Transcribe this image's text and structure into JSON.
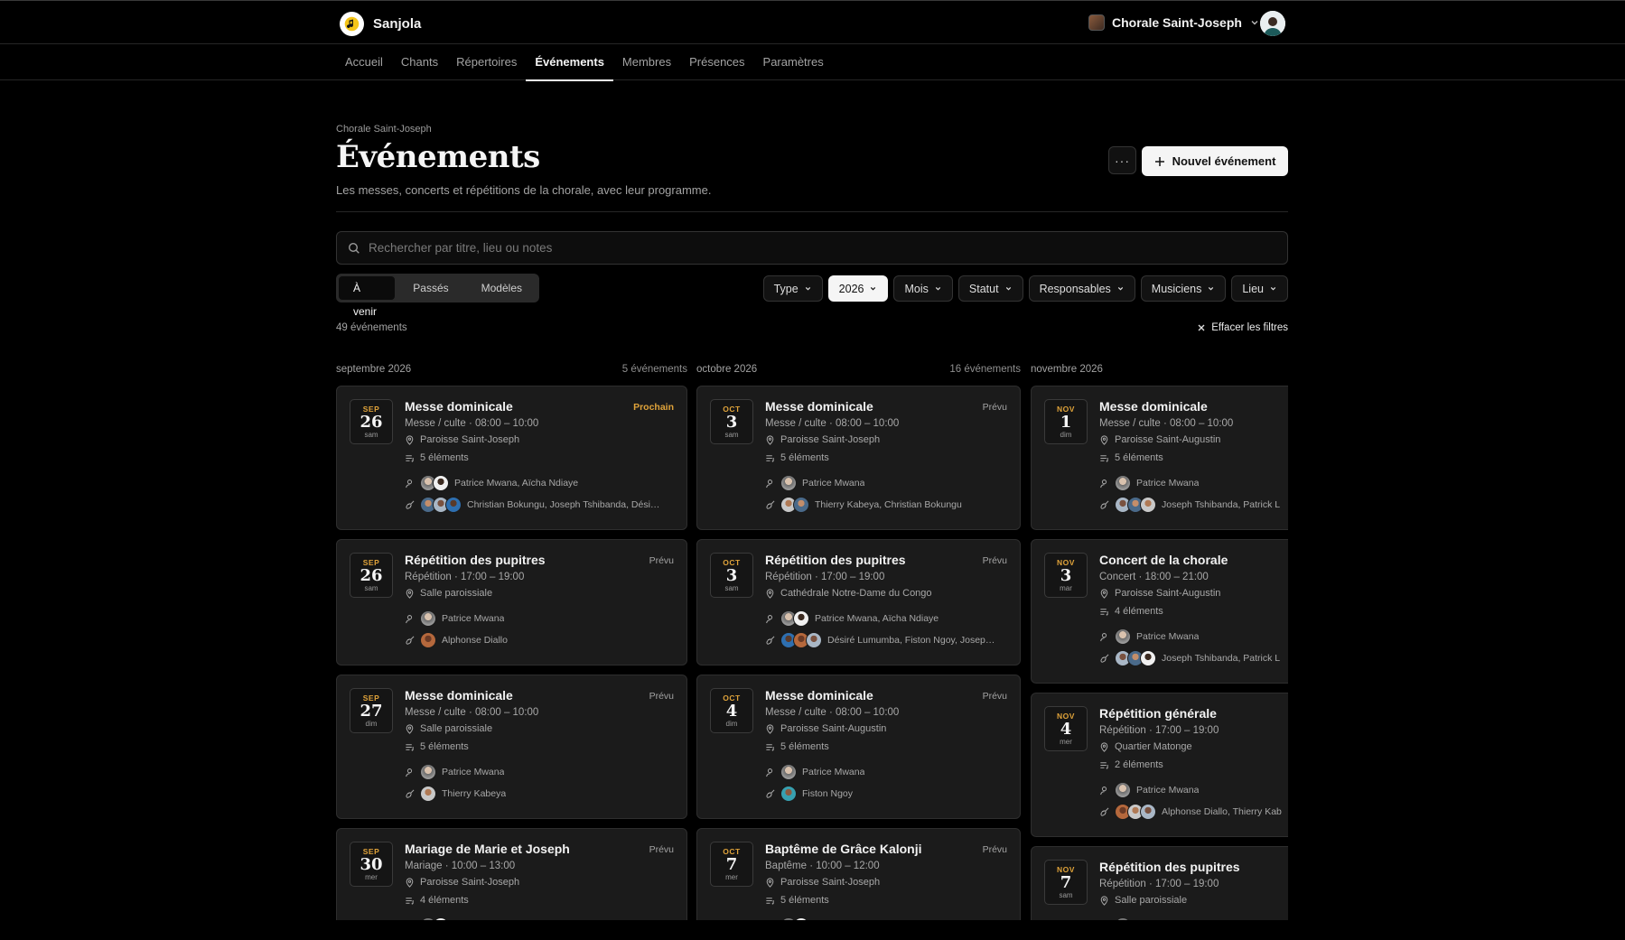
{
  "app": {
    "name": "Sanjola",
    "org": "Chorale Saint-Joseph"
  },
  "nav": {
    "tabs": [
      {
        "label": "Accueil"
      },
      {
        "label": "Chants"
      },
      {
        "label": "Répertoires"
      },
      {
        "label": "Événements",
        "active": true
      },
      {
        "label": "Membres"
      },
      {
        "label": "Présences"
      },
      {
        "label": "Paramètres"
      }
    ]
  },
  "header": {
    "breadcrumb": "Chorale Saint-Joseph",
    "title": "Événements",
    "subtitle": "Les messes, concerts et répétitions de la chorale, avec leur programme.",
    "more_label": "···",
    "new_button": "Nouvel événement"
  },
  "search": {
    "placeholder": "Rechercher par titre, lieu ou notes",
    "value": ""
  },
  "segments": [
    {
      "label": "À venir",
      "active": true
    },
    {
      "label": "Passés"
    },
    {
      "label": "Modèles"
    }
  ],
  "filters": [
    {
      "label": "Type"
    },
    {
      "label": "2026",
      "active": true
    },
    {
      "label": "Mois"
    },
    {
      "label": "Statut"
    },
    {
      "label": "Responsables"
    },
    {
      "label": "Musiciens"
    },
    {
      "label": "Lieu"
    }
  ],
  "summary": {
    "count": "49 événements",
    "clear": "Effacer les filtres"
  },
  "colors": {
    "accent": "#e0a33a",
    "background": "#000000",
    "card": "#1b1b1b"
  },
  "columns": [
    {
      "month": "septembre 2026",
      "count": "5 événements",
      "events": [
        {
          "mon": "SEP",
          "day": "26",
          "dow": "sam",
          "title": "Messe dominicale",
          "status": "Prochain",
          "next": true,
          "meta": "Messe / culte · 08:00 – 10:00",
          "place": "Paroisse Saint-Joseph",
          "items": "5 éléments",
          "leads": "Patrice Mwana, Aïcha Ndiaye",
          "lead_avatars": [
            "a1",
            "a2"
          ],
          "musicians": "Christian Bokungu, Joseph Tshibanda, Dési…",
          "mus_avatars": [
            "a3",
            "a4",
            "a5"
          ]
        },
        {
          "mon": "SEP",
          "day": "26",
          "dow": "sam",
          "title": "Répétition des pupitres",
          "status": "Prévu",
          "meta": "Répétition · 17:00 – 19:00",
          "place": "Salle paroissiale",
          "leads": "Patrice Mwana",
          "lead_avatars": [
            "a1"
          ],
          "musicians": "Alphonse Diallo",
          "mus_avatars": [
            "a7"
          ]
        },
        {
          "mon": "SEP",
          "day": "27",
          "dow": "dim",
          "title": "Messe dominicale",
          "status": "Prévu",
          "meta": "Messe / culte · 08:00 – 10:00",
          "place": "Salle paroissiale",
          "items": "5 éléments",
          "leads": "Patrice Mwana",
          "lead_avatars": [
            "a1"
          ],
          "musicians": "Thierry Kabeya",
          "mus_avatars": [
            "a6"
          ]
        },
        {
          "mon": "SEP",
          "day": "30",
          "dow": "mer",
          "title": "Mariage de Marie et Joseph",
          "status": "Prévu",
          "meta": "Mariage · 10:00 – 13:00",
          "place": "Paroisse Saint-Joseph",
          "items": "4 éléments",
          "leads": "",
          "lead_avatars": [
            "a1",
            "a2"
          ],
          "musicians": "",
          "mus_avatars": []
        }
      ]
    },
    {
      "month": "octobre 2026",
      "count": "16 événements",
      "events": [
        {
          "mon": "OCT",
          "day": "3",
          "dow": "sam",
          "title": "Messe dominicale",
          "status": "Prévu",
          "meta": "Messe / culte · 08:00 – 10:00",
          "place": "Paroisse Saint-Joseph",
          "items": "5 éléments",
          "leads": "Patrice Mwana",
          "lead_avatars": [
            "a1"
          ],
          "musicians": "Thierry Kabeya, Christian Bokungu",
          "mus_avatars": [
            "a6",
            "a3"
          ]
        },
        {
          "mon": "OCT",
          "day": "3",
          "dow": "sam",
          "title": "Répétition des pupitres",
          "status": "Prévu",
          "meta": "Répétition · 17:00 – 19:00",
          "place": "Cathédrale Notre-Dame du Congo",
          "leads": "Patrice Mwana, Aïcha Ndiaye",
          "lead_avatars": [
            "a1",
            "a2"
          ],
          "musicians": "Désiré Lumumba, Fiston Ngoy, Josep…",
          "mus_avatars": [
            "a5",
            "a7",
            "a4"
          ]
        },
        {
          "mon": "OCT",
          "day": "4",
          "dow": "dim",
          "title": "Messe dominicale",
          "status": "Prévu",
          "meta": "Messe / culte · 08:00 – 10:00",
          "place": "Paroisse Saint-Augustin",
          "items": "5 éléments",
          "leads": "Patrice Mwana",
          "lead_avatars": [
            "a1"
          ],
          "musicians": "Fiston Ngoy",
          "mus_avatars": [
            "a8"
          ]
        },
        {
          "mon": "OCT",
          "day": "7",
          "dow": "mer",
          "title": "Baptême de Grâce Kalonji",
          "status": "Prévu",
          "meta": "Baptême · 10:00 – 12:00",
          "place": "Paroisse Saint-Joseph",
          "items": "5 éléments",
          "leads": "",
          "lead_avatars": [
            "a1",
            "a2"
          ],
          "musicians": "",
          "mus_avatars": []
        }
      ]
    },
    {
      "month": "novembre 2026",
      "count": "",
      "events": [
        {
          "mon": "NOV",
          "day": "1",
          "dow": "dim",
          "title": "Messe dominicale",
          "status": "",
          "meta": "Messe / culte · 08:00 – 10:00",
          "place": "Paroisse Saint-Augustin",
          "items": "5 éléments",
          "leads": "Patrice Mwana",
          "lead_avatars": [
            "a1"
          ],
          "musicians": "Joseph Tshibanda, Patrick L",
          "mus_avatars": [
            "a4",
            "a3",
            "a6"
          ]
        },
        {
          "mon": "NOV",
          "day": "3",
          "dow": "mar",
          "title": "Concert de la chorale",
          "status": "",
          "meta": "Concert · 18:00 – 21:00",
          "place": "Paroisse Saint-Augustin",
          "items": "4 éléments",
          "leads": "Patrice Mwana",
          "lead_avatars": [
            "a1"
          ],
          "musicians": "Joseph Tshibanda, Patrick L",
          "mus_avatars": [
            "a4",
            "a3",
            "a2"
          ]
        },
        {
          "mon": "NOV",
          "day": "4",
          "dow": "mer",
          "title": "Répétition générale",
          "status": "",
          "meta": "Répétition · 17:00 – 19:00",
          "place": "Quartier Matonge",
          "items": "2 éléments",
          "leads": "Patrice Mwana",
          "lead_avatars": [
            "a1"
          ],
          "musicians": "Alphonse Diallo, Thierry Kab",
          "mus_avatars": [
            "a7",
            "a6",
            "a4"
          ]
        },
        {
          "mon": "NOV",
          "day": "7",
          "dow": "sam",
          "title": "Répétition des pupitres",
          "status": "",
          "meta": "Répétition · 17:00 – 19:00",
          "place": "Salle paroissiale",
          "leads": "",
          "lead_avatars": [
            "a1"
          ],
          "musicians": "",
          "mus_avatars": []
        }
      ]
    }
  ]
}
